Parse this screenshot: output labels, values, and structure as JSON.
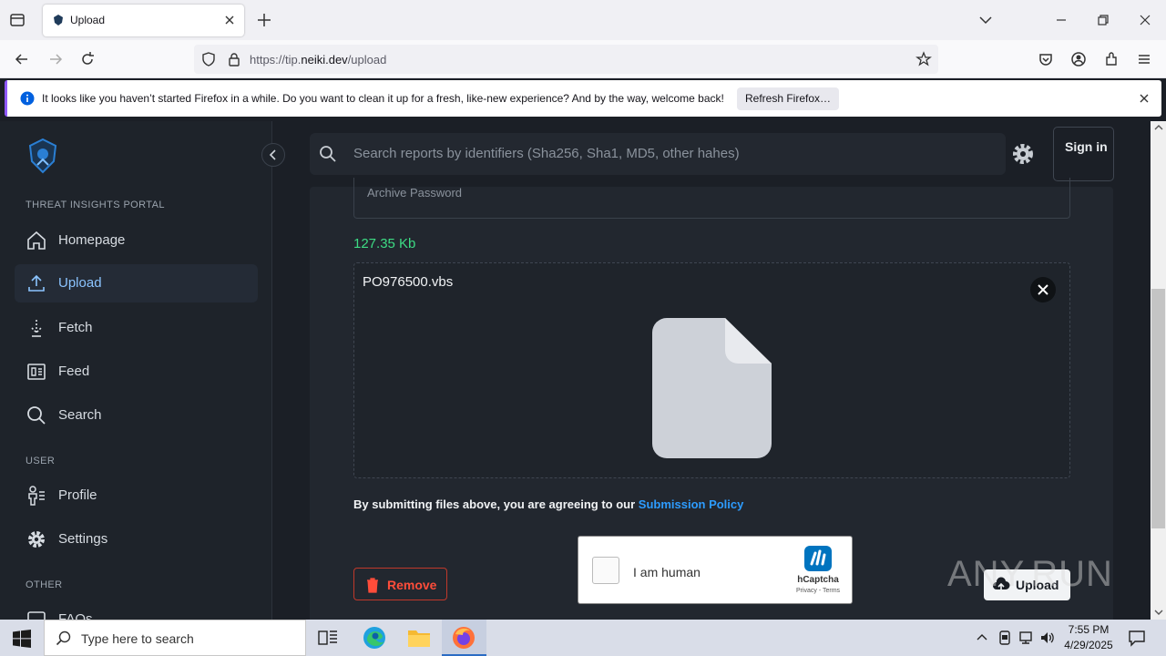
{
  "browser": {
    "tab_title": "Upload",
    "url_prefix": "https://tip.",
    "url_domain": "neiki.dev",
    "url_path": "/upload",
    "notification": "It looks like you haven’t started Firefox in a while. Do you want to clean it up for a fresh, like-new experience? And by the way, welcome back!",
    "refresh_label": "Refresh Firefox…"
  },
  "sidebar": {
    "portal_label": "THREAT INSIGHTS PORTAL",
    "items": [
      {
        "label": "Homepage"
      },
      {
        "label": "Upload"
      },
      {
        "label": "Fetch"
      },
      {
        "label": "Feed"
      },
      {
        "label": "Search"
      }
    ],
    "user_label": "USER",
    "user_items": [
      {
        "label": "Profile"
      },
      {
        "label": "Settings"
      }
    ],
    "other_label": "OTHER",
    "other_items": [
      {
        "label": "FAQs"
      }
    ]
  },
  "header": {
    "search_placeholder": "Search reports by identifiers (Sha256, Sha1, MD5, other hahes)",
    "sign_in": "Sign in"
  },
  "upload": {
    "password_placeholder": "Archive Password",
    "file_size": "127.35 Kb",
    "file_name": "PO976500.vbs",
    "policy_text": "By submitting files above, you are agreeing to our ",
    "policy_link": "Submission Policy",
    "remove_label": "Remove",
    "upload_label": "Upload"
  },
  "captcha": {
    "label": "I am human",
    "brand": "hCaptcha",
    "terms": "Privacy - Terms"
  },
  "watermark": "ANY.RUN",
  "taskbar": {
    "search_placeholder": "Type here to search",
    "time": "7:55 PM",
    "date": "4/29/2025"
  },
  "colors": {
    "accent_link": "#2d9cff",
    "file_size": "#3ddc84",
    "danger": "#ff4d3a"
  }
}
